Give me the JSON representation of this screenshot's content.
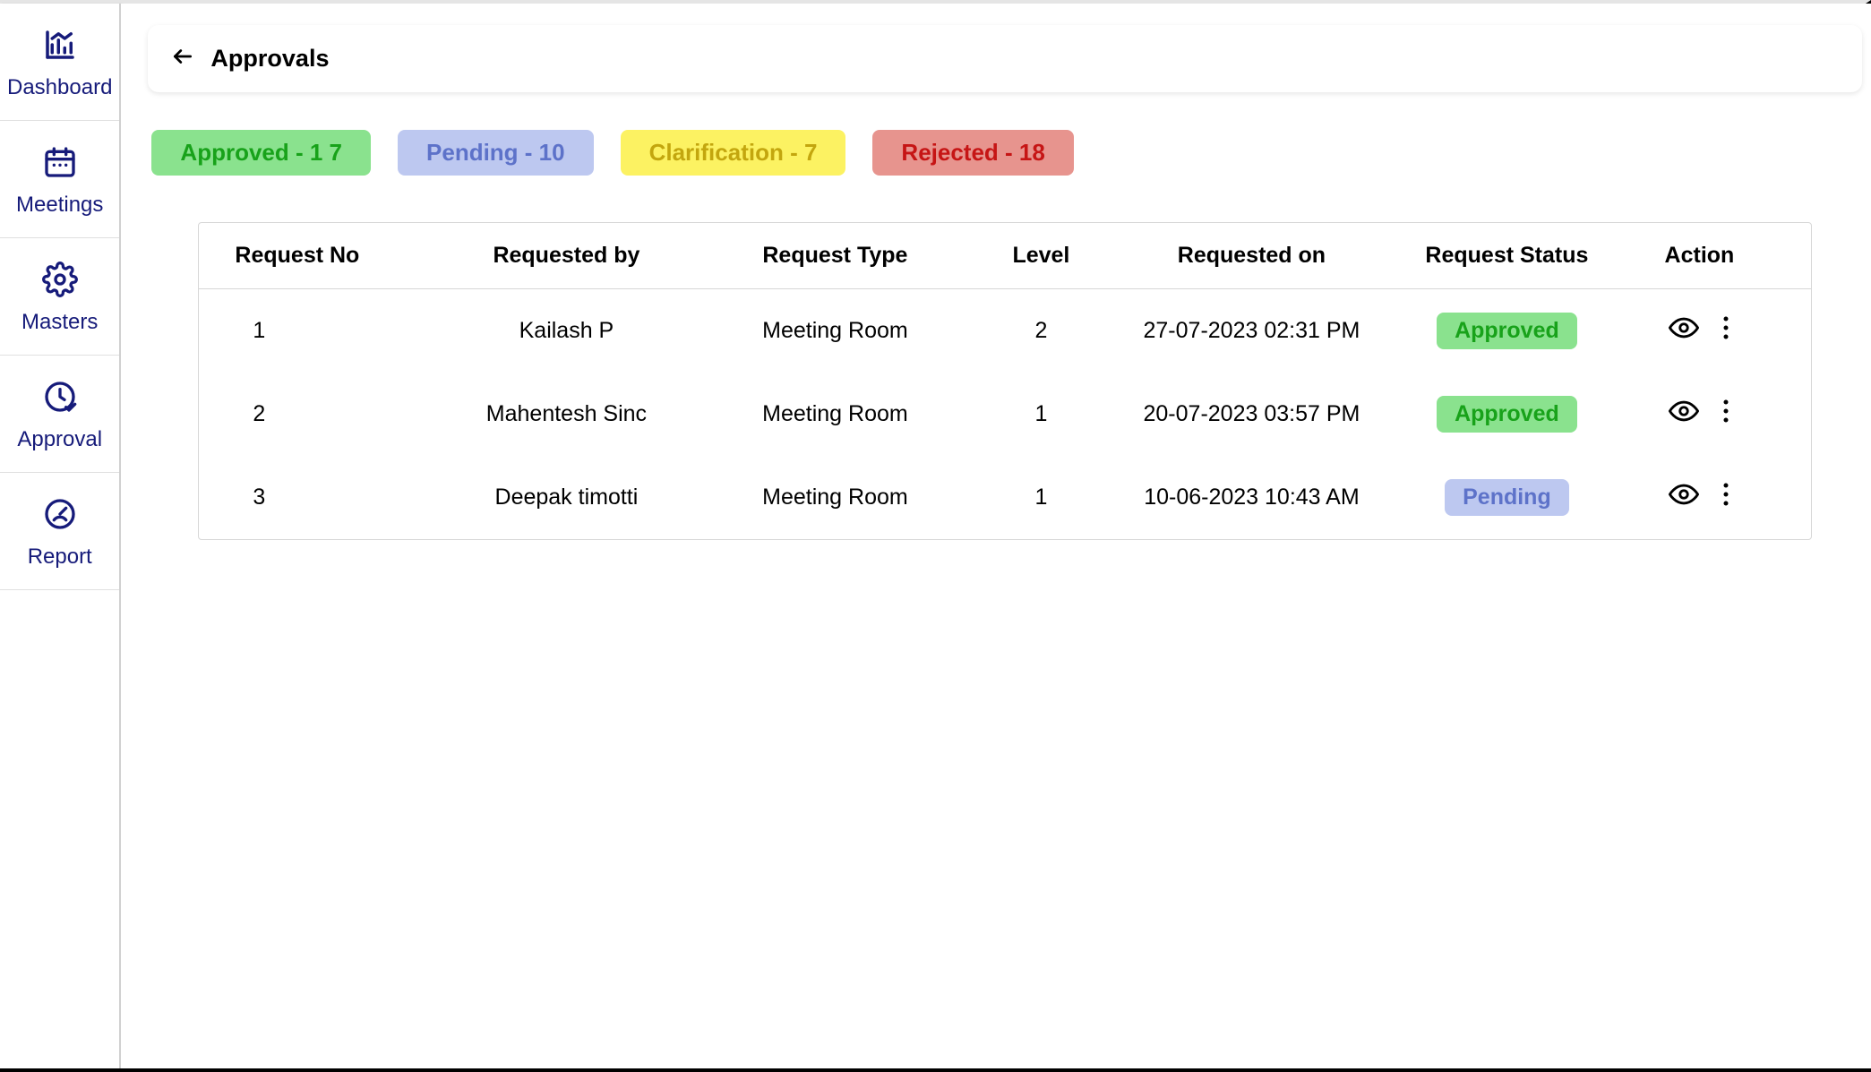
{
  "sidebar": {
    "items": [
      {
        "label": "Dashboard",
        "icon": "dashboard"
      },
      {
        "label": "Meetings",
        "icon": "calendar"
      },
      {
        "label": "Masters",
        "icon": "gear"
      },
      {
        "label": "Approval",
        "icon": "clock-check"
      },
      {
        "label": "Report",
        "icon": "gauge"
      }
    ]
  },
  "header": {
    "title": "Approvals"
  },
  "filters": {
    "approved_label": "Approved - 1 7",
    "pending_label": "Pending - 10",
    "clarification_label": "Clarification - 7",
    "rejected_label": "Rejected - 18"
  },
  "table": {
    "columns": {
      "request_no": "Request No",
      "requested_by": "Requested by",
      "request_type": "Request Type",
      "level": "Level",
      "requested_on": "Requested on",
      "request_status": "Request Status",
      "action": "Action"
    },
    "rows": [
      {
        "no": "1",
        "by": "Kailash P",
        "type": "Meeting Room",
        "level": "2",
        "on": "27-07-2023 02:31 PM",
        "status": "Approved",
        "status_class": "approved"
      },
      {
        "no": "2",
        "by": "Mahentesh Sinc",
        "type": "Meeting Room",
        "level": "1",
        "on": "20-07-2023 03:57 PM",
        "status": "Approved",
        "status_class": "approved"
      },
      {
        "no": "3",
        "by": "Deepak timotti",
        "type": "Meeting Room",
        "level": "1",
        "on": "10-06-2023 10:43 AM",
        "status": "Pending",
        "status_class": "pending"
      }
    ]
  }
}
